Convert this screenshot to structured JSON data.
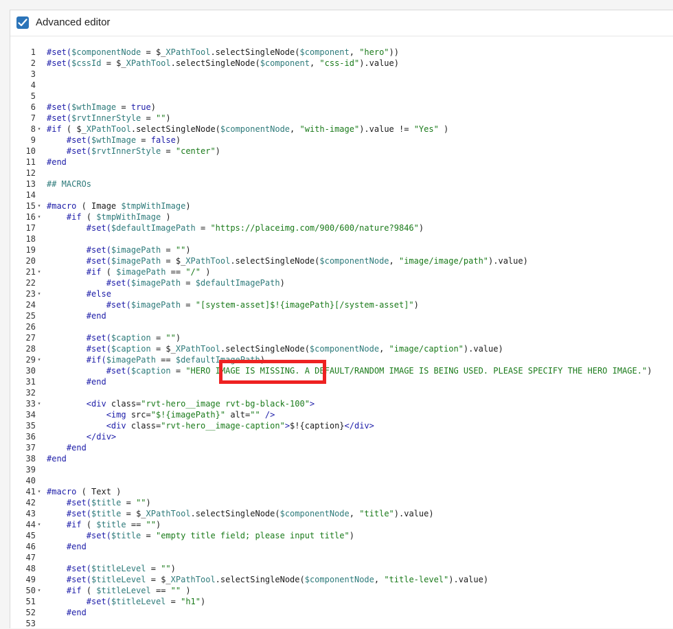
{
  "header": {
    "checkbox_checked": true,
    "label": "Advanced editor"
  },
  "colors": {
    "accent": "#2b74b9",
    "highlight_border": "#ee2222"
  },
  "editor": {
    "lines": [
      {
        "n": "1",
        "fold": false,
        "tokens": [
          [
            "d",
            "#set("
          ],
          [
            "v",
            "$componentNode"
          ],
          [
            "p",
            " = $_"
          ],
          [
            "v",
            "XPathTool"
          ],
          [
            "p",
            ".selectSingleNode("
          ],
          [
            "v",
            "$component"
          ],
          [
            "p",
            ", "
          ],
          [
            "s",
            "\"hero\""
          ],
          [
            "p",
            "))"
          ]
        ]
      },
      {
        "n": "2",
        "fold": false,
        "tokens": [
          [
            "d",
            "#set("
          ],
          [
            "v",
            "$cssId"
          ],
          [
            "p",
            " = $_"
          ],
          [
            "v",
            "XPathTool"
          ],
          [
            "p",
            ".selectSingleNode("
          ],
          [
            "v",
            "$component"
          ],
          [
            "p",
            ", "
          ],
          [
            "s",
            "\"css-id\""
          ],
          [
            "p",
            ").value)"
          ]
        ]
      },
      {
        "n": "3",
        "fold": false,
        "tokens": []
      },
      {
        "n": "4",
        "fold": false,
        "tokens": []
      },
      {
        "n": "5",
        "fold": false,
        "tokens": []
      },
      {
        "n": "6",
        "fold": false,
        "tokens": [
          [
            "d",
            "#set("
          ],
          [
            "v",
            "$wthImage"
          ],
          [
            "p",
            " = "
          ],
          [
            "d",
            "true"
          ],
          [
            "p",
            ")"
          ]
        ]
      },
      {
        "n": "7",
        "fold": false,
        "tokens": [
          [
            "d",
            "#set("
          ],
          [
            "v",
            "$rvtInnerStyle"
          ],
          [
            "p",
            " = "
          ],
          [
            "s",
            "\"\""
          ],
          [
            "p",
            ")"
          ]
        ]
      },
      {
        "n": "8",
        "fold": true,
        "tokens": [
          [
            "d",
            "#if"
          ],
          [
            "p",
            " ( $_"
          ],
          [
            "v",
            "XPathTool"
          ],
          [
            "p",
            ".selectSingleNode("
          ],
          [
            "v",
            "$componentNode"
          ],
          [
            "p",
            ", "
          ],
          [
            "s",
            "\"with-image\""
          ],
          [
            "p",
            ").value != "
          ],
          [
            "s",
            "\"Yes\""
          ],
          [
            "p",
            " )"
          ]
        ]
      },
      {
        "n": "9",
        "fold": false,
        "tokens": [
          [
            "p",
            "    "
          ],
          [
            "d",
            "#set("
          ],
          [
            "v",
            "$wthImage"
          ],
          [
            "p",
            " = "
          ],
          [
            "d",
            "false"
          ],
          [
            "p",
            ")"
          ]
        ]
      },
      {
        "n": "10",
        "fold": false,
        "tokens": [
          [
            "p",
            "    "
          ],
          [
            "d",
            "#set("
          ],
          [
            "v",
            "$rvtInnerStyle"
          ],
          [
            "p",
            " = "
          ],
          [
            "s",
            "\"center\""
          ],
          [
            "p",
            ")"
          ]
        ]
      },
      {
        "n": "11",
        "fold": false,
        "tokens": [
          [
            "d",
            "#end"
          ]
        ]
      },
      {
        "n": "12",
        "fold": false,
        "tokens": []
      },
      {
        "n": "13",
        "fold": false,
        "tokens": [
          [
            "c",
            "## MACROs"
          ]
        ]
      },
      {
        "n": "14",
        "fold": false,
        "tokens": []
      },
      {
        "n": "15",
        "fold": true,
        "tokens": [
          [
            "d",
            "#macro"
          ],
          [
            "p",
            " ( Image "
          ],
          [
            "v",
            "$tmpWithImage"
          ],
          [
            "p",
            ")"
          ]
        ]
      },
      {
        "n": "16",
        "fold": true,
        "tokens": [
          [
            "p",
            "    "
          ],
          [
            "d",
            "#if"
          ],
          [
            "p",
            " ( "
          ],
          [
            "v",
            "$tmpWithImage"
          ],
          [
            "p",
            " )"
          ]
        ]
      },
      {
        "n": "17",
        "fold": false,
        "tokens": [
          [
            "p",
            "        "
          ],
          [
            "d",
            "#set("
          ],
          [
            "v",
            "$defaultImagePath"
          ],
          [
            "p",
            " = "
          ],
          [
            "s",
            "\"https://placeimg.com/900/600/nature?9846\""
          ],
          [
            "p",
            ")"
          ]
        ]
      },
      {
        "n": "18",
        "fold": false,
        "tokens": []
      },
      {
        "n": "19",
        "fold": false,
        "tokens": [
          [
            "p",
            "        "
          ],
          [
            "d",
            "#set("
          ],
          [
            "v",
            "$imagePath"
          ],
          [
            "p",
            " = "
          ],
          [
            "s",
            "\"\""
          ],
          [
            "p",
            ")"
          ]
        ]
      },
      {
        "n": "20",
        "fold": false,
        "tokens": [
          [
            "p",
            "        "
          ],
          [
            "d",
            "#set("
          ],
          [
            "v",
            "$imagePath"
          ],
          [
            "p",
            " = $_"
          ],
          [
            "v",
            "XPathTool"
          ],
          [
            "p",
            ".selectSingleNode("
          ],
          [
            "v",
            "$componentNode"
          ],
          [
            "p",
            ", "
          ],
          [
            "s",
            "\"image/image/path\""
          ],
          [
            "p",
            ").value)"
          ]
        ]
      },
      {
        "n": "21",
        "fold": true,
        "tokens": [
          [
            "p",
            "        "
          ],
          [
            "d",
            "#if"
          ],
          [
            "p",
            " ( "
          ],
          [
            "v",
            "$imagePath"
          ],
          [
            "p",
            " == "
          ],
          [
            "s",
            "\"/\""
          ],
          [
            "p",
            " )"
          ]
        ]
      },
      {
        "n": "22",
        "fold": false,
        "tokens": [
          [
            "p",
            "            "
          ],
          [
            "d",
            "#set("
          ],
          [
            "v",
            "$imagePath"
          ],
          [
            "p",
            " = "
          ],
          [
            "v",
            "$defaultImagePath"
          ],
          [
            "p",
            ")"
          ]
        ]
      },
      {
        "n": "23",
        "fold": true,
        "tokens": [
          [
            "p",
            "        "
          ],
          [
            "d",
            "#else"
          ]
        ]
      },
      {
        "n": "24",
        "fold": false,
        "tokens": [
          [
            "p",
            "            "
          ],
          [
            "d",
            "#set("
          ],
          [
            "v",
            "$imagePath"
          ],
          [
            "p",
            " = "
          ],
          [
            "s",
            "\"[system-asset]$!{imagePath}[/system-asset]\""
          ],
          [
            "p",
            ")"
          ]
        ]
      },
      {
        "n": "25",
        "fold": false,
        "tokens": [
          [
            "p",
            "        "
          ],
          [
            "d",
            "#end"
          ]
        ]
      },
      {
        "n": "26",
        "fold": false,
        "tokens": []
      },
      {
        "n": "27",
        "fold": false,
        "tokens": [
          [
            "p",
            "        "
          ],
          [
            "d",
            "#set("
          ],
          [
            "v",
            "$caption"
          ],
          [
            "p",
            " = "
          ],
          [
            "s",
            "\"\""
          ],
          [
            "p",
            ")"
          ]
        ]
      },
      {
        "n": "28",
        "fold": false,
        "tokens": [
          [
            "p",
            "        "
          ],
          [
            "d",
            "#set("
          ],
          [
            "v",
            "$caption"
          ],
          [
            "p",
            " = $_"
          ],
          [
            "v",
            "XPathTool"
          ],
          [
            "p",
            ".selectSingleNode("
          ],
          [
            "v",
            "$componentNode"
          ],
          [
            "p",
            ", "
          ],
          [
            "s",
            "\"image/caption\""
          ],
          [
            "p",
            ").value)"
          ]
        ]
      },
      {
        "n": "29",
        "fold": true,
        "tokens": [
          [
            "p",
            "        "
          ],
          [
            "d",
            "#if("
          ],
          [
            "v",
            "$imagePath"
          ],
          [
            "p",
            " == "
          ],
          [
            "v",
            "$defaultImagePath"
          ],
          [
            "p",
            ")"
          ]
        ]
      },
      {
        "n": "30",
        "fold": false,
        "tokens": [
          [
            "p",
            "            "
          ],
          [
            "d",
            "#set("
          ],
          [
            "v",
            "$caption"
          ],
          [
            "p",
            " = "
          ],
          [
            "s",
            "\"HERO IMAGE IS MISSING. A DEFAULT/RANDOM IMAGE IS BEING USED. PLEASE SPECIFY THE HERO IMAGE.\""
          ],
          [
            "p",
            ")"
          ]
        ]
      },
      {
        "n": "31",
        "fold": false,
        "tokens": [
          [
            "p",
            "        "
          ],
          [
            "d",
            "#end"
          ]
        ]
      },
      {
        "n": "32",
        "fold": false,
        "tokens": []
      },
      {
        "n": "33",
        "fold": true,
        "tokens": [
          [
            "p",
            "        "
          ],
          [
            "t",
            "<div"
          ],
          [
            "p",
            " class="
          ],
          [
            "s",
            "\"rvt-hero__image rvt-bg-black-100\""
          ],
          [
            "t",
            ">"
          ]
        ]
      },
      {
        "n": "34",
        "fold": false,
        "tokens": [
          [
            "p",
            "            "
          ],
          [
            "t",
            "<img"
          ],
          [
            "p",
            " src="
          ],
          [
            "s",
            "\"$!{imagePath}\""
          ],
          [
            "p",
            " alt="
          ],
          [
            "s",
            "\"\""
          ],
          [
            "p",
            " "
          ],
          [
            "t",
            "/>"
          ]
        ]
      },
      {
        "n": "35",
        "fold": false,
        "tokens": [
          [
            "p",
            "            "
          ],
          [
            "t",
            "<div"
          ],
          [
            "p",
            " class="
          ],
          [
            "s",
            "\"rvt-hero__image-caption\""
          ],
          [
            "t",
            ">"
          ],
          [
            "p",
            "$!{caption}"
          ],
          [
            "t",
            "</div>"
          ]
        ]
      },
      {
        "n": "36",
        "fold": false,
        "tokens": [
          [
            "p",
            "        "
          ],
          [
            "t",
            "</div>"
          ]
        ]
      },
      {
        "n": "37",
        "fold": false,
        "tokens": [
          [
            "p",
            "    "
          ],
          [
            "d",
            "#end"
          ]
        ]
      },
      {
        "n": "38",
        "fold": false,
        "tokens": [
          [
            "d",
            "#end"
          ]
        ]
      },
      {
        "n": "39",
        "fold": false,
        "tokens": []
      },
      {
        "n": "40",
        "fold": false,
        "tokens": []
      },
      {
        "n": "41",
        "fold": true,
        "tokens": [
          [
            "d",
            "#macro"
          ],
          [
            "p",
            " ( Text )"
          ]
        ]
      },
      {
        "n": "42",
        "fold": false,
        "tokens": [
          [
            "p",
            "    "
          ],
          [
            "d",
            "#set("
          ],
          [
            "v",
            "$title"
          ],
          [
            "p",
            " = "
          ],
          [
            "s",
            "\"\""
          ],
          [
            "p",
            ")"
          ]
        ]
      },
      {
        "n": "43",
        "fold": false,
        "tokens": [
          [
            "p",
            "    "
          ],
          [
            "d",
            "#set("
          ],
          [
            "v",
            "$title"
          ],
          [
            "p",
            " = $_"
          ],
          [
            "v",
            "XPathTool"
          ],
          [
            "p",
            ".selectSingleNode("
          ],
          [
            "v",
            "$componentNode"
          ],
          [
            "p",
            ", "
          ],
          [
            "s",
            "\"title\""
          ],
          [
            "p",
            ").value)"
          ]
        ]
      },
      {
        "n": "44",
        "fold": true,
        "tokens": [
          [
            "p",
            "    "
          ],
          [
            "d",
            "#if"
          ],
          [
            "p",
            " ( "
          ],
          [
            "v",
            "$title"
          ],
          [
            "p",
            " == "
          ],
          [
            "s",
            "\"\""
          ],
          [
            "p",
            ")"
          ]
        ]
      },
      {
        "n": "45",
        "fold": false,
        "tokens": [
          [
            "p",
            "        "
          ],
          [
            "d",
            "#set("
          ],
          [
            "v",
            "$title"
          ],
          [
            "p",
            " = "
          ],
          [
            "s",
            "\"empty title field; please input title\""
          ],
          [
            "p",
            ")"
          ]
        ]
      },
      {
        "n": "46",
        "fold": false,
        "tokens": [
          [
            "p",
            "    "
          ],
          [
            "d",
            "#end"
          ]
        ]
      },
      {
        "n": "47",
        "fold": false,
        "tokens": []
      },
      {
        "n": "48",
        "fold": false,
        "tokens": [
          [
            "p",
            "    "
          ],
          [
            "d",
            "#set("
          ],
          [
            "v",
            "$titleLevel"
          ],
          [
            "p",
            " = "
          ],
          [
            "s",
            "\"\""
          ],
          [
            "p",
            ")"
          ]
        ]
      },
      {
        "n": "49",
        "fold": false,
        "tokens": [
          [
            "p",
            "    "
          ],
          [
            "d",
            "#set("
          ],
          [
            "v",
            "$titleLevel"
          ],
          [
            "p",
            " = $_"
          ],
          [
            "v",
            "XPathTool"
          ],
          [
            "p",
            ".selectSingleNode("
          ],
          [
            "v",
            "$componentNode"
          ],
          [
            "p",
            ", "
          ],
          [
            "s",
            "\"title-level\""
          ],
          [
            "p",
            ").value)"
          ]
        ]
      },
      {
        "n": "50",
        "fold": true,
        "tokens": [
          [
            "p",
            "    "
          ],
          [
            "d",
            "#if"
          ],
          [
            "p",
            " ( "
          ],
          [
            "v",
            "$titleLevel"
          ],
          [
            "p",
            " == "
          ],
          [
            "s",
            "\"\""
          ],
          [
            "p",
            " )"
          ]
        ]
      },
      {
        "n": "51",
        "fold": false,
        "tokens": [
          [
            "p",
            "        "
          ],
          [
            "d",
            "#set("
          ],
          [
            "v",
            "$titleLevel"
          ],
          [
            "p",
            " = "
          ],
          [
            "s",
            "\"h1\""
          ],
          [
            "p",
            ")"
          ]
        ]
      },
      {
        "n": "52",
        "fold": false,
        "tokens": [
          [
            "p",
            "    "
          ],
          [
            "d",
            "#end"
          ]
        ]
      },
      {
        "n": "53",
        "fold": false,
        "tokens": []
      }
    ]
  }
}
